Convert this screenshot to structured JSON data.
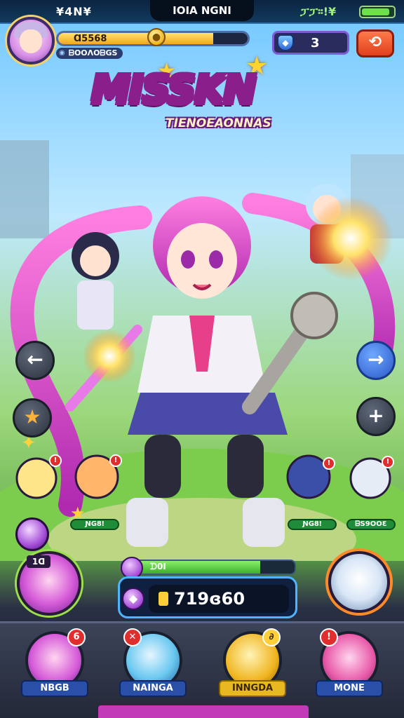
{
  "status_bar": {
    "left_text": "¥4Ν¥",
    "center_text": "IOIA NGNI",
    "right_text": "ፓፓ።!¥",
    "battery_level": 0.82
  },
  "player": {
    "xp_text": "Ɑ5568",
    "xp_fraction": 0.82,
    "sub_text": "ᗷOOΛOᗷGS",
    "level_value": "3"
  },
  "title": {
    "main": "MISSKN",
    "subtitle": "TIENOEAONNAS"
  },
  "characters": {
    "left_top_tag": "ƝG8ǃ",
    "right_top_tag": "ᗷS9OOƐ"
  },
  "power": {
    "label": "ᗪ0Ι",
    "value": "719ɞ60",
    "fill_fraction": 0.8
  },
  "player_portrait_tag": "1ᗡ",
  "dock": [
    {
      "label": "NBGB",
      "badge": "6",
      "style": "blue"
    },
    {
      "label": "NAINGA",
      "badge": "✕",
      "style": "blue"
    },
    {
      "label": "INNGDA",
      "badge": "∂",
      "style": "gold"
    },
    {
      "label": "MONE",
      "badge": "!",
      "style": "blue"
    }
  ],
  "colors": {
    "accent_pink": "#e83fb0",
    "accent_orange": "#ff8a1f",
    "xp_gold": "#f5a623",
    "power_border": "#4fb4ff"
  }
}
